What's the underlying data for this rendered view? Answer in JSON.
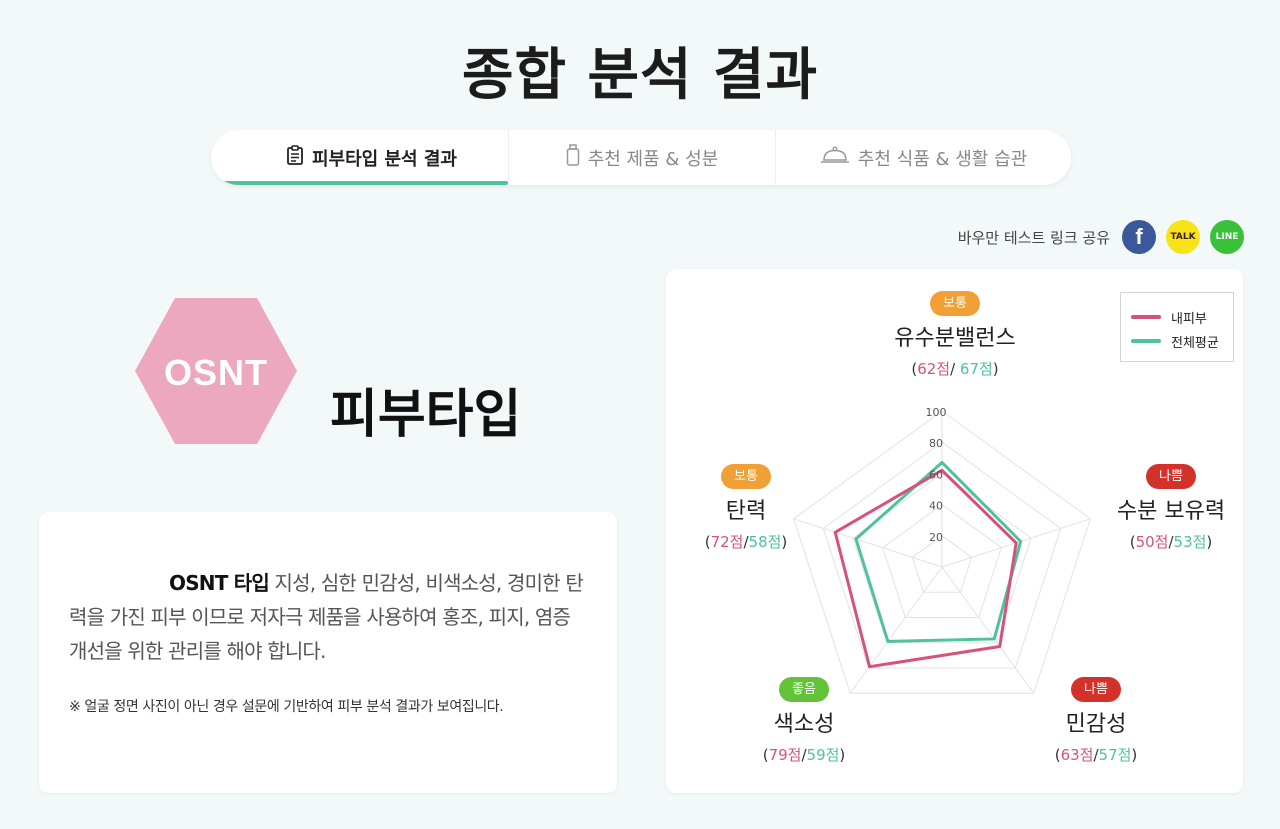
{
  "page": {
    "title": "종합 분석 결과"
  },
  "tabs": [
    {
      "label": "피부타입 분석 결과",
      "icon": "clipboard-icon",
      "active": true
    },
    {
      "label": "추천 제품 & 성분",
      "icon": "bottle-icon",
      "active": false
    },
    {
      "label": "추천 식품 & 생활 습관",
      "icon": "food-cloche-icon",
      "active": false
    }
  ],
  "share": {
    "label": "바우만 테스트 링크 공유",
    "buttons": [
      {
        "name": "facebook",
        "text": "f",
        "color": "#3b5998"
      },
      {
        "name": "kakaotalk",
        "text": "TALK",
        "color": "#f7e317"
      },
      {
        "name": "line",
        "text": "LINE",
        "color": "#3ac13a"
      }
    ]
  },
  "skin_type": {
    "code": "OSNT",
    "label": "피부타입",
    "badge_color": "#eca8bf"
  },
  "description": {
    "type_label": "OSNT 타입",
    "text": " 지성, 심한 민감성, 비색소성, 경미한 탄력을 가진 피부 이므로 저자극 제품을 사용하여 홍조, 피지, 염증 개선을 위한 관리를 해야 합니다.",
    "note": "※ 얼굴 정면 사진이 아닌 경우 설문에 기반하여 피부 분석 결과가 보여집니다."
  },
  "legend": {
    "mine": "내피부",
    "avg": "전체평균"
  },
  "colors": {
    "mine": "#d6527a",
    "avg": "#4fc1a1",
    "normal": "#f0a035",
    "bad": "#d3322a",
    "good": "#63c13a"
  },
  "axes": [
    {
      "name": "유수분밸런스",
      "status": "보통",
      "status_key": "normal",
      "mine_label": "62점",
      "avg_label": "67점",
      "sep": "/ "
    },
    {
      "name": "수분 보유력",
      "status": "나쁨",
      "status_key": "bad",
      "mine_label": "50점",
      "avg_label": "53점",
      "sep": "/"
    },
    {
      "name": "민감성",
      "status": "나쁨",
      "status_key": "bad",
      "mine_label": "63점",
      "avg_label": "57점",
      "sep": "/"
    },
    {
      "name": "색소성",
      "status": "좋음",
      "status_key": "good",
      "mine_label": "79점",
      "avg_label": "59점",
      "sep": "/"
    },
    {
      "name": "탄력",
      "status": "보통",
      "status_key": "normal",
      "mine_label": "72점",
      "avg_label": "58점",
      "sep": "/"
    }
  ],
  "chart_data": {
    "type": "radar",
    "categories": [
      "유수분밸런스",
      "수분 보유력",
      "민감성",
      "색소성",
      "탄력"
    ],
    "series": [
      {
        "name": "내피부",
        "values": [
          62,
          50,
          63,
          79,
          72
        ]
      },
      {
        "name": "전체평균",
        "values": [
          67,
          53,
          57,
          59,
          58
        ]
      }
    ],
    "rlim": [
      0,
      100
    ],
    "ticks": [
      20,
      40,
      60,
      80,
      100
    ],
    "legend": "top-right"
  }
}
